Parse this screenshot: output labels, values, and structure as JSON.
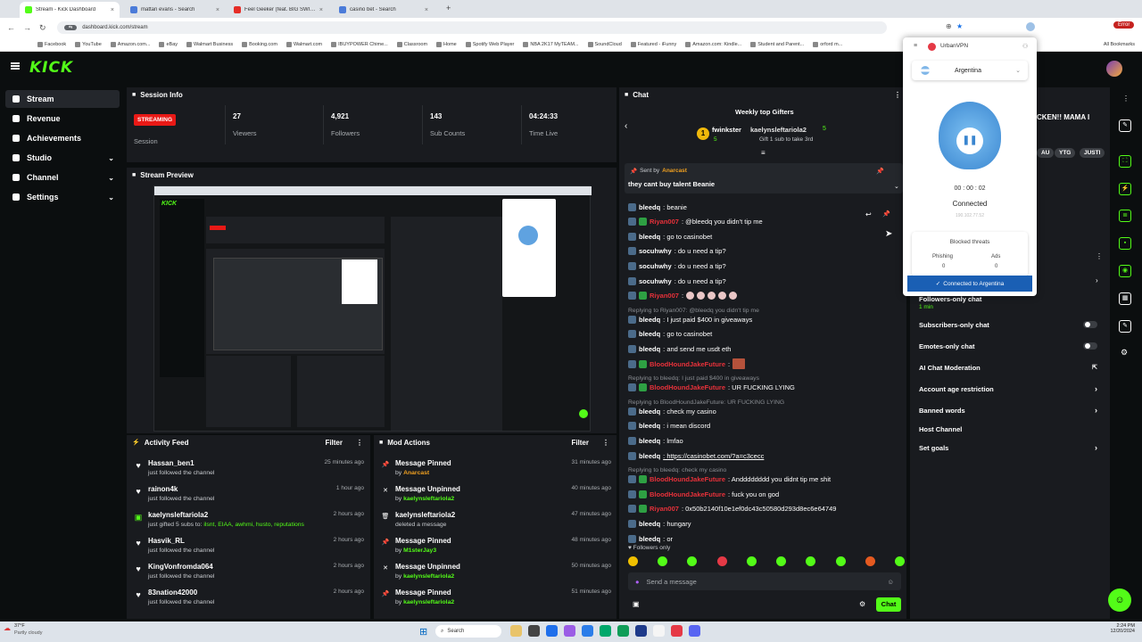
{
  "browser": {
    "tabs": [
      {
        "label": "Stream - Kick Dashboard",
        "active": true,
        "color": "#53fc18"
      },
      {
        "label": "mattan evans - Search",
        "active": false,
        "color": "#4b7bd9"
      },
      {
        "label": "Feel Geeker (feat. BIG SWIMMI...",
        "active": false,
        "color": "#e52d27"
      },
      {
        "label": "casino bet - Search",
        "active": false,
        "color": "#4b7bd9"
      }
    ],
    "url": "dashboard.kick.com/stream",
    "bookmarks": [
      "Facebook",
      "YouTube",
      "Amazon.com...",
      "eBay",
      "Walmart Business",
      "Booking.com",
      "Walmart.com",
      "IBUYPOWER Chime...",
      "Classroom",
      "Home",
      "Spotify Web Player",
      "NBA 2K17 MyTEAM...",
      "SoundCloud",
      "Featured - iFunny",
      "Amazon.com: Kindle...",
      "Student and Parent...",
      "orford m..."
    ],
    "all_bookmarks": "All Bookmarks",
    "error_label": "Error"
  },
  "sidebar": {
    "items": [
      {
        "label": "Stream",
        "active": true,
        "chevron": false
      },
      {
        "label": "Revenue",
        "active": false,
        "chevron": false
      },
      {
        "label": "Achievements",
        "active": false,
        "chevron": false
      },
      {
        "label": "Studio",
        "active": false,
        "chevron": true
      },
      {
        "label": "Channel",
        "active": false,
        "chevron": true
      },
      {
        "label": "Settings",
        "active": false,
        "chevron": true
      }
    ]
  },
  "session": {
    "title": "Session Info",
    "status_badge": "STREAMING",
    "status_label": "Session",
    "stats": [
      {
        "value": "27",
        "label": "Viewers"
      },
      {
        "value": "4,921",
        "label": "Followers"
      },
      {
        "value": "143",
        "label": "Sub Counts"
      },
      {
        "value": "04:24:33",
        "label": "Time Live"
      }
    ]
  },
  "preview": {
    "title": "Stream Preview"
  },
  "activity": {
    "title": "Activity Feed",
    "filter": "Filter",
    "items": [
      {
        "icon": "heart",
        "name": "Hassan_ben1",
        "sub": "just followed the channel",
        "time": "25 minutes ago"
      },
      {
        "icon": "heart",
        "name": "rainon4k",
        "sub": "just followed the channel",
        "time": "1 hour ago"
      },
      {
        "icon": "gift",
        "name": "kaelynsleftariola2",
        "sub": "just gifted 5 subs to: ",
        "sub_highlight": "ilsnt, EIAA, awhmi, husto, reputations",
        "time": "2 hours ago"
      },
      {
        "icon": "heart",
        "name": "Hasvik_RL",
        "sub": "just followed the channel",
        "time": "2 hours ago"
      },
      {
        "icon": "heart",
        "name": "KingVonfromda064",
        "sub": "just followed the channel",
        "time": "2 hours ago"
      },
      {
        "icon": "heart",
        "name": "83nation42000",
        "sub": "just followed the channel",
        "time": "2 hours ago"
      }
    ]
  },
  "modactions": {
    "title": "Mod Actions",
    "filter": "Filter",
    "items": [
      {
        "icon": "pin",
        "name": "Message Pinned",
        "by": "by ",
        "by_user": "Anarcast",
        "time": "31 minutes ago"
      },
      {
        "icon": "unpin",
        "name": "Message Unpinned",
        "by": "by ",
        "by_user": "kaelynsleftariola2",
        "time": "40 minutes ago"
      },
      {
        "icon": "trash",
        "name": "kaelynsleftariola2",
        "by": "deleted a message",
        "by_user": "",
        "time": "47 minutes ago"
      },
      {
        "icon": "pin",
        "name": "Message Pinned",
        "by": "by ",
        "by_user": "M1sterJay3",
        "time": "48 minutes ago"
      },
      {
        "icon": "unpin",
        "name": "Message Unpinned",
        "by": "by ",
        "by_user": "kaelynsleftariola2",
        "time": "50 minutes ago"
      },
      {
        "icon": "pin",
        "name": "Message Pinned",
        "by": "by ",
        "by_user": "kaelynsleftariola2",
        "time": "51 minutes ago"
      }
    ]
  },
  "chat": {
    "title": "Chat",
    "gifters_title": "Weekly top Gifters",
    "gifter1": "fwinkster",
    "gifter1_count": "5",
    "gifter2": "kaelynsleftariola2",
    "gifter2_count": "5",
    "gift_sub": "Gift 1 sub to take 3rd",
    "pinned_by_label": "Sent by",
    "pinned_by": "Anarcast",
    "pinned_message": "they cant buy talent Beanie",
    "messages": [
      {
        "user": "bleedq",
        "text": ": beanie",
        "red": false,
        "reply": ""
      },
      {
        "user": "Riyan007",
        "text": ": @bleedq you didn't tip me",
        "red": true,
        "reply": ""
      },
      {
        "user": "bleedq",
        "text": ": go to casinobet",
        "red": false,
        "reply": ""
      },
      {
        "user": "socuhwhy",
        "text": ": do u need a tip?",
        "red": false,
        "reply": ""
      },
      {
        "user": "socuhwhy",
        "text": ": do u need a tip?",
        "red": false,
        "reply": ""
      },
      {
        "user": "socuhwhy",
        "text": ": do u need a tip?",
        "red": false,
        "reply": ""
      },
      {
        "user": "Riyan007",
        "text": ":",
        "red": true,
        "reply": "",
        "emotes": 5
      },
      {
        "user": "bleedq",
        "text": ": I just paid $400 in giveaways",
        "red": false,
        "reply": "Replying to Riyan007: @bleedq you didn't tip me"
      },
      {
        "user": "bleedq",
        "text": ": go to casinobet",
        "red": false,
        "reply": ""
      },
      {
        "user": "bleedq",
        "text": ": and send me usdt eth",
        "red": false,
        "reply": ""
      },
      {
        "user": "BloodHoundJakeFuture",
        "text": ":",
        "red": true,
        "reply": "",
        "emotes": 1
      },
      {
        "user": "BloodHoundJakeFuture",
        "text": ": UR FUCKING LYING",
        "red": true,
        "reply": "Replying to bleedq: I just paid $400 in giveaways"
      },
      {
        "user": "bleedq",
        "text": ": check my casino",
        "red": false,
        "reply": "Replying to BloodHoundJakeFuture: UR FUCKING LYING"
      },
      {
        "user": "bleedq",
        "text": ": i mean discord",
        "red": false,
        "reply": ""
      },
      {
        "user": "bleedq",
        "text": ": lmfao",
        "red": false,
        "reply": ""
      },
      {
        "user": "bleedq",
        "text": ": https://casinobet.com/?a=c3cecc",
        "red": false,
        "reply": ""
      },
      {
        "user": "BloodHoundJakeFuture",
        "text": ": Andddddddd you didnt tip me shit",
        "red": true,
        "reply": "Replying to bleedq: check my casino"
      },
      {
        "user": "BloodHoundJakeFuture",
        "text": ": fuck you on god",
        "red": true,
        "reply": ""
      },
      {
        "user": "Riyan007",
        "text": ": 0x50b2140f10e1ef0dc43c50580d293d8ec6e64749",
        "red": true,
        "reply": ""
      },
      {
        "user": "bleedq",
        "text": ": hungary",
        "red": false,
        "reply": ""
      },
      {
        "user": "bleedq",
        "text": ": or",
        "red": false,
        "reply": ""
      }
    ],
    "followers_only": "Followers only",
    "input_placeholder": "Send a message",
    "send_label": "Chat"
  },
  "settings_panel": {
    "partial_text": "CKEN!! MAMA I",
    "tags": [
      "AU",
      "YTG",
      "JUSTI"
    ],
    "followers_only": "Followers-only chat",
    "followers_only_sub": "1 min",
    "items": [
      {
        "label": "Subscribers-only chat",
        "control": "toggle"
      },
      {
        "label": "Emotes-only chat",
        "control": "toggle"
      },
      {
        "label": "AI Chat Moderation",
        "control": "link"
      },
      {
        "label": "Account age restriction",
        "control": "chevron"
      },
      {
        "label": "Banned words",
        "control": "chevron"
      },
      {
        "label": "Host Channel",
        "control": "none"
      },
      {
        "label": "Set goals",
        "control": "chevron"
      }
    ]
  },
  "vpn": {
    "brand": "UrbanVPN",
    "country": "Argentina",
    "timer": "00 : 00 : 02",
    "status": "Connected",
    "ip": "190.102.77.52",
    "blocked_title": "Blocked threats",
    "phishing_label": "Phishing",
    "phishing_value": "0",
    "ads_label": "Ads",
    "ads_value": "0",
    "connected_to": "Connected to Argentina"
  },
  "taskbar": {
    "weather_temp": "37°F",
    "weather_desc": "Partly cloudy",
    "search": "Search",
    "time": "2:24 PM",
    "date": "12/20/2024"
  },
  "colors": {
    "kick_green": "#53fc18",
    "streaming_red": "#e91916",
    "panel": "#191b1f"
  }
}
